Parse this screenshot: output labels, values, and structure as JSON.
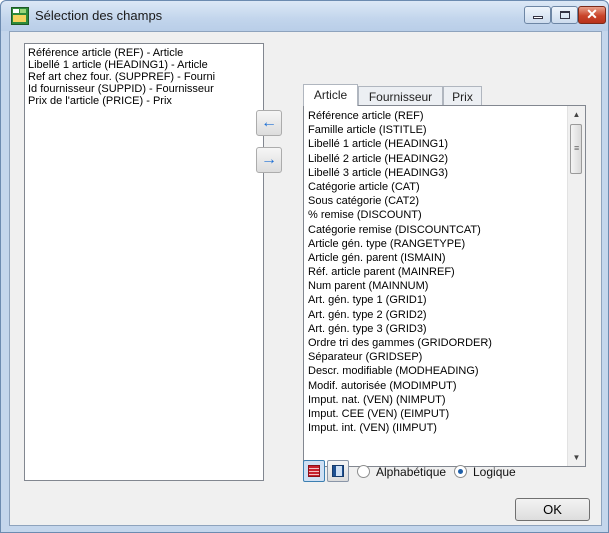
{
  "window": {
    "title": "Sélection des champs",
    "controls": {
      "minimize": "minimize",
      "maximize": "maximize",
      "close": "✕"
    }
  },
  "selected_fields": [
    "Référence article (REF) - Article",
    "Libellé 1 article (HEADING1) - Article",
    "Ref art chez four. (SUPPREF) - Fourni",
    "Id fournisseur (SUPPID) - Fournisseur",
    "Prix de l'article (PRICE) - Prix"
  ],
  "move_buttons": {
    "add": "←",
    "remove": "→"
  },
  "tabs": [
    {
      "label": "Article",
      "active": true
    },
    {
      "label": "Fournisseur",
      "active": false
    },
    {
      "label": "Prix",
      "active": false
    }
  ],
  "available_fields": [
    "Référence article (REF)",
    "Famille article (ISTITLE)",
    "Libellé 1 article (HEADING1)",
    "Libellé 2 article (HEADING2)",
    "Libellé 3 article (HEADING3)",
    "Catégorie article (CAT)",
    "Sous catégorie (CAT2)",
    "% remise (DISCOUNT)",
    "Catégorie remise (DISCOUNTCAT)",
    "Article gén. type (RANGETYPE)",
    "Article gén. parent (ISMAIN)",
    "Réf. article parent (MAINREF)",
    "Num parent (MAINNUM)",
    "Art. gén. type 1 (GRID1)",
    "Art. gén. type 2 (GRID2)",
    "Art. gén. type 3 (GRID3)",
    "Ordre tri des gammes (GRIDORDER)",
    "Séparateur (GRIDSEP)",
    "Descr. modifiable (MODHEADING)",
    "Modif. autorisée (MODIMPUT)",
    "Imput. nat. (VEN) (NIMPUT)",
    "Imput. CEE (VEN) (EIMPUT)",
    "Imput. int. (VEN) (IIMPUT)"
  ],
  "scrollbar": {
    "up": "▲",
    "down": "▼",
    "grip": "≡",
    "position": 0.05
  },
  "sort": {
    "options": [
      {
        "label": "Alphabétique",
        "checked": false
      },
      {
        "label": "Logique",
        "checked": true
      }
    ]
  },
  "ok_label": "OK",
  "colors": {
    "accent": "#1d6fd4",
    "title_bg": "#c2d5ec",
    "close_red": "#c9442a"
  }
}
